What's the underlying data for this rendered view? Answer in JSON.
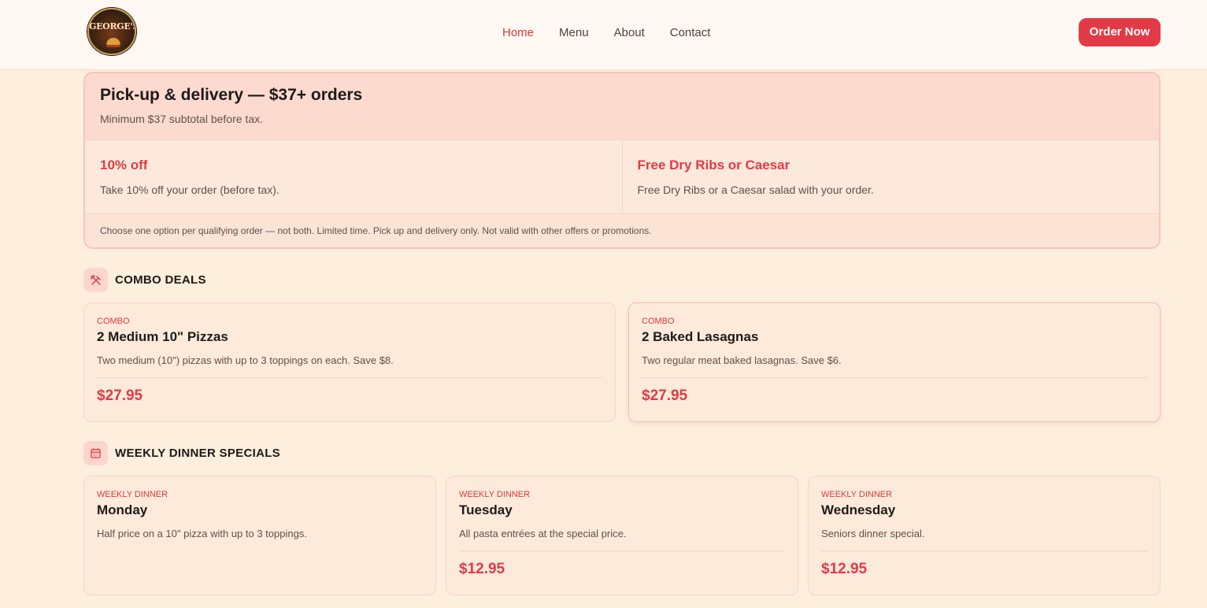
{
  "header": {
    "logo_text": "GEORGE'S",
    "nav": [
      "Home",
      "Menu",
      "About",
      "Contact"
    ],
    "active_nav": "Home",
    "order_button": "Order Now"
  },
  "promo": {
    "title": "Pick-up & delivery — $37+ orders",
    "subtitle": "Minimum $37 subtotal before tax.",
    "options": [
      {
        "title": "10% off",
        "desc": "Take 10% off your order (before tax)."
      },
      {
        "title": "Free Dry Ribs or Caesar",
        "desc": "Free Dry Ribs or a Caesar salad with your order."
      }
    ],
    "note": "Choose one option per qualifying order — not both. Limited time. Pick up and delivery only. Not valid with other offers or promotions."
  },
  "combo": {
    "heading": "COMBO DEALS",
    "icon": "utensils-crossed-icon",
    "items": [
      {
        "tag": "COMBO",
        "title": "2 Medium 10\" Pizzas",
        "desc": "Two medium (10\") pizzas with up to 3 toppings on each. Save $8.",
        "price": "$27.95"
      },
      {
        "tag": "COMBO",
        "title": "2 Baked Lasagnas",
        "desc": "Two regular meat baked lasagnas. Save $6.",
        "price": "$27.95"
      }
    ]
  },
  "weekly": {
    "heading": "WEEKLY DINNER SPECIALS",
    "icon": "calendar-icon",
    "items": [
      {
        "tag": "WEEKLY DINNER",
        "title": "Monday",
        "desc": "Half price on a 10\" pizza with up to 3 toppings.",
        "price": ""
      },
      {
        "tag": "WEEKLY DINNER",
        "title": "Tuesday",
        "desc": "All pasta entrées at the special price.",
        "price": "$12.95"
      },
      {
        "tag": "WEEKLY DINNER",
        "title": "Wednesday",
        "desc": "Seniors dinner special.",
        "price": "$12.95"
      }
    ]
  },
  "colors": {
    "accent": "#e23a46",
    "background": "#fdeedd",
    "header": "#fff8f3"
  }
}
